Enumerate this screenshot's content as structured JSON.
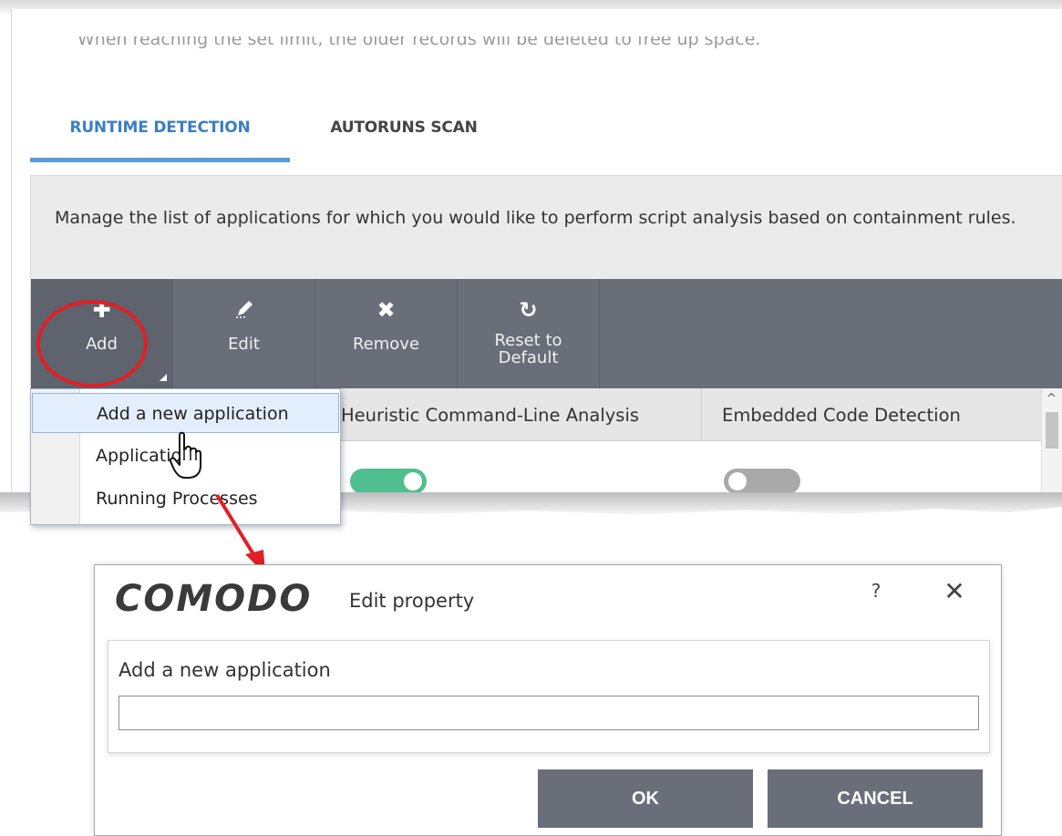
{
  "background_panel": {
    "truncated_text": "When reaching the set limit, the older records will be deleted to free up space.",
    "tabs": [
      {
        "label": "RUNTIME DETECTION",
        "active": true
      },
      {
        "label": "AUTORUNS SCAN",
        "active": false
      }
    ],
    "description": "Manage the list of applications for which you would like to perform script analysis based on containment rules.",
    "toolbar": {
      "add": {
        "icon": "plus-icon",
        "label": "Add"
      },
      "edit": {
        "icon": "pencil-icon",
        "label": "Edit"
      },
      "remove": {
        "icon": "x-icon",
        "label": "Remove"
      },
      "reset": {
        "icon": "refresh-icon",
        "label_line1": "Reset to",
        "label_line2": "Default"
      }
    },
    "table": {
      "columns": [
        "Heuristic Command-Line Analysis",
        "Embedded Code Detection"
      ],
      "rows": [
        {
          "heuristic_enabled": true,
          "embedded_enabled": false
        }
      ]
    }
  },
  "add_dropdown": {
    "items": [
      "Add a new application",
      "Applications",
      "Running Processes"
    ],
    "highlighted_index": 0
  },
  "dialog": {
    "brand": "COMODO",
    "title": "Edit property",
    "help_label": "?",
    "close_label": "✕",
    "field_label": "Add a new application",
    "field_value": "",
    "ok_label": "OK",
    "cancel_label": "CANCEL"
  },
  "colors": {
    "toolbar": "#696e79",
    "tab_active": "#3b7fc4",
    "toggle_on": "#4fbf8f",
    "toggle_off": "#a9a9a9",
    "annotation_red": "#e01f26"
  }
}
